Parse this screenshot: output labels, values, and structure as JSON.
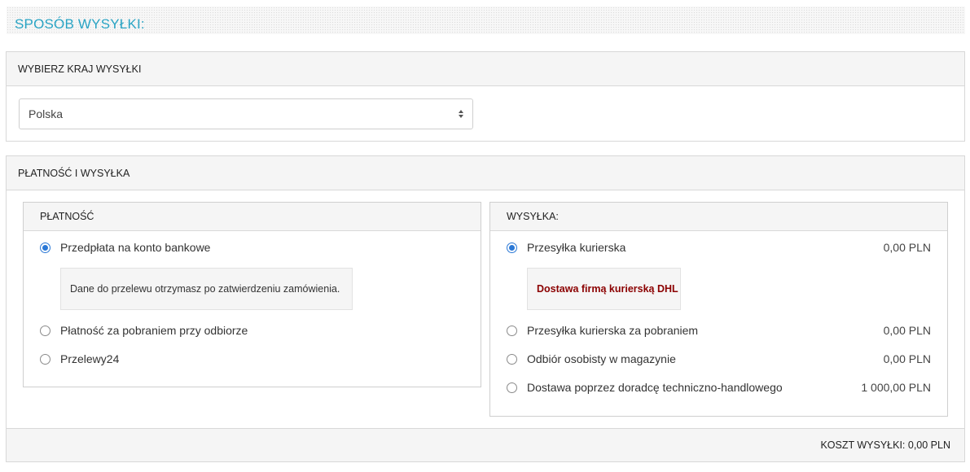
{
  "header": {
    "title": "SPOSÓB WYSYŁKI:"
  },
  "country": {
    "heading": "WYBIERZ KRAJ WYSYŁKI",
    "selected": "Polska"
  },
  "pay_ship": {
    "heading": "PŁATNOŚĆ I WYSYŁKA",
    "payment": {
      "heading": "PŁATNOŚĆ",
      "options": [
        {
          "label": "Przedpłata na konto bankowe",
          "checked": true
        },
        {
          "label": "Płatność za pobraniem przy odbiorze",
          "checked": false
        },
        {
          "label": "Przelewy24",
          "checked": false
        }
      ],
      "info": "Dane do przelewu otrzymasz po zatwierdzeniu zamówienia."
    },
    "shipping": {
      "heading": "WYSYŁKA:",
      "options": [
        {
          "label": "Przesyłka kurierska",
          "price": "0,00 PLN",
          "checked": true
        },
        {
          "label": "Przesyłka kurierska za pobraniem",
          "price": "0,00 PLN",
          "checked": false
        },
        {
          "label": "Odbiór osobisty w magazynie",
          "price": "0,00 PLN",
          "checked": false
        },
        {
          "label": "Dostawa poprzez doradcę techniczno-handlowego",
          "price": "1 000,00 PLN",
          "checked": false
        }
      ],
      "info": "Dostawa firmą kurierską DHL"
    },
    "footer": "KOSZT WYSYŁKI: 0,00 PLN"
  },
  "colors": {
    "accent_title": "#2aa4c4",
    "radio_checked": "#2a78d6",
    "info_highlight": "#8b0000"
  }
}
